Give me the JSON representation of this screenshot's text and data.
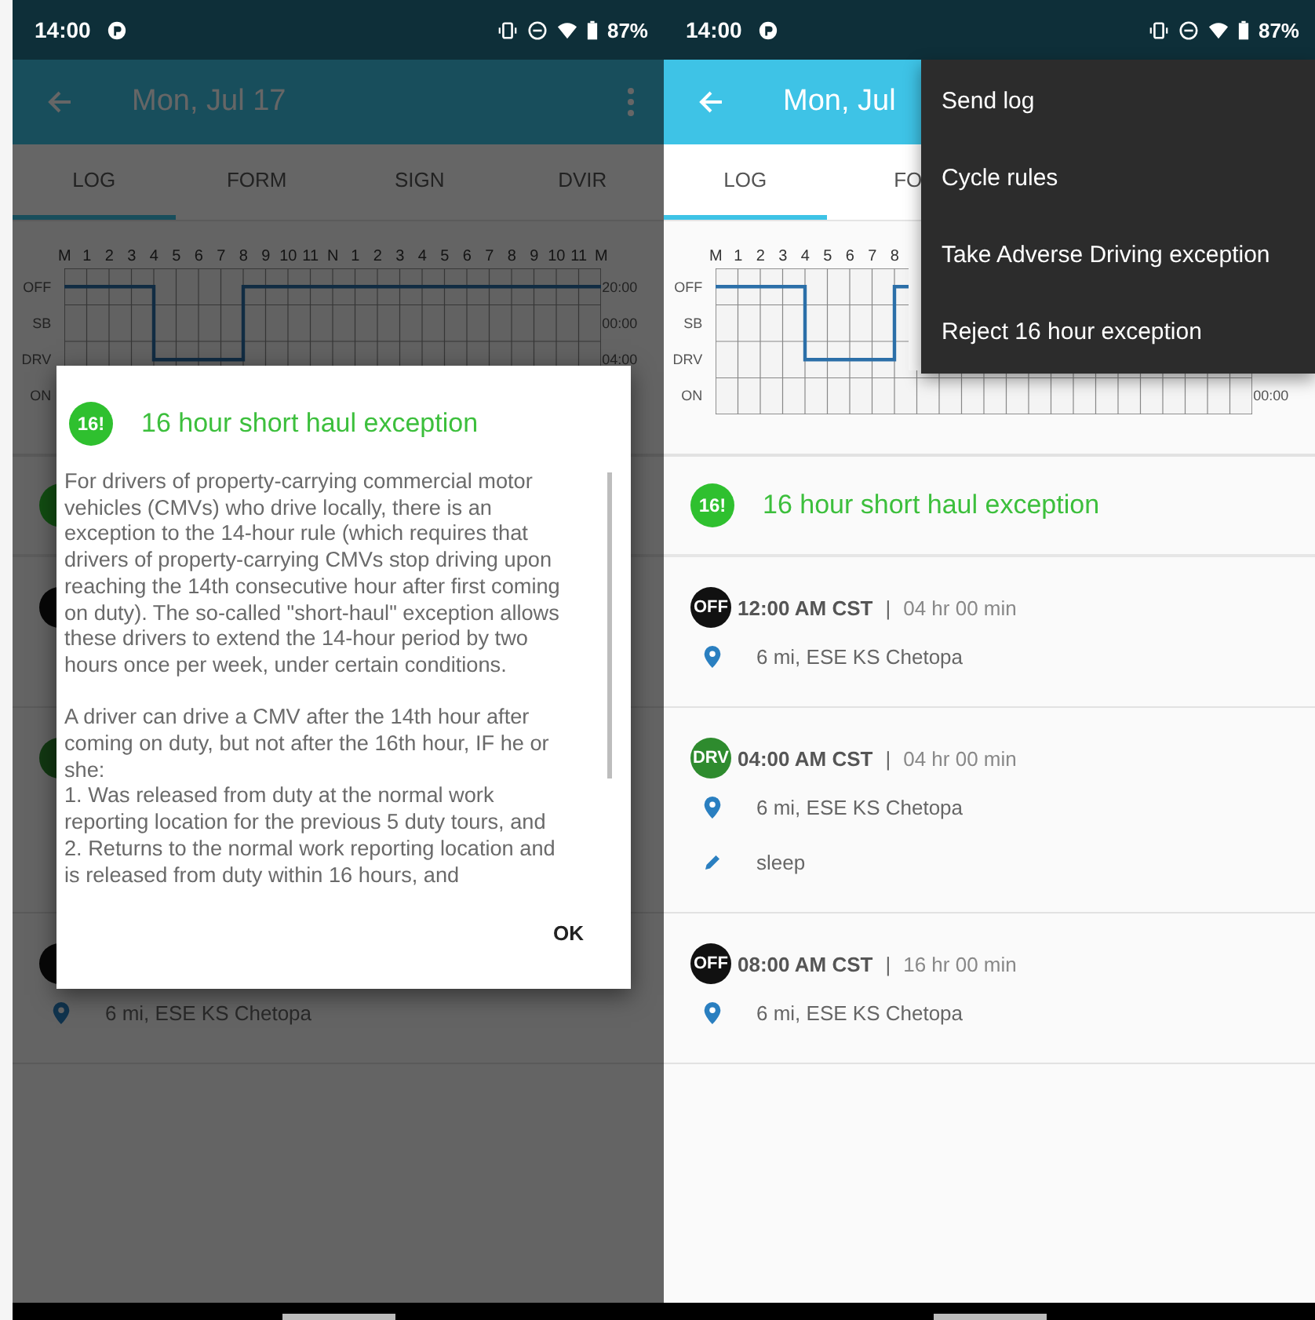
{
  "phones": [
    {
      "status_bar": {
        "time": "14:00",
        "battery": "87%"
      },
      "app_bar": {
        "title": "Mon, Jul 17",
        "more_icon": true
      },
      "tabs": [
        {
          "label": "LOG",
          "selected": true
        },
        {
          "label": "FORM",
          "selected": false
        },
        {
          "label": "SIGN",
          "selected": false
        },
        {
          "label": "DVIR",
          "selected": false
        }
      ],
      "log_chart": {
        "hours": [
          "M",
          "1",
          "2",
          "3",
          "4",
          "5",
          "6",
          "7",
          "8",
          "9",
          "10",
          "11",
          "N",
          "1",
          "2",
          "3",
          "4",
          "5",
          "6",
          "7",
          "8",
          "9",
          "10",
          "11",
          "M"
        ],
        "rows": [
          {
            "label": "OFF",
            "total": "20:00"
          },
          {
            "label": "SB",
            "total": "00:00"
          },
          {
            "label": "DRV",
            "total": "04:00"
          },
          {
            "label": "ON"
          }
        ]
      },
      "list": [
        {
          "kind": "exception"
        },
        {
          "kind": "event",
          "color": "#070707",
          "lines": [
            {
              "kind": "location"
            }
          ]
        },
        {
          "kind": "event",
          "color": "#123812",
          "lines": [
            {
              "kind": "location"
            },
            {
              "kind": "note"
            }
          ]
        },
        {
          "kind": "event",
          "color": "#070707",
          "lines": [
            {
              "kind": "location",
              "text": "6 mi, ESE KS Chetopa"
            }
          ]
        }
      ],
      "dialog": {
        "badge": "16!",
        "title": "16 hour short haul exception",
        "body": "For drivers of property-carrying commercial motor vehicles (CMVs) who drive locally, there is an exception to the 14-hour rule (which requires that drivers of property-carrying CMVs stop driving upon reaching the 14th consecutive hour after first coming on duty). The so-called \"short-haul\" exception allows these drivers to extend the 14-hour period by two hours once per week, under certain conditions.\n\nA driver can drive a CMV after the 14th hour after coming on duty, but not after the 16th hour, IF he or she:\n1. Was released from duty at the normal work reporting location for the previous 5 duty tours, and\n2. Returns to the normal work reporting location and is released from duty within 16 hours, and",
        "button": "OK"
      }
    },
    {
      "status_bar": {
        "time": "14:00",
        "battery": "87%"
      },
      "app_bar": {
        "title": "Mon, Jul"
      },
      "tabs": [
        {
          "label": "LOG",
          "selected": true
        },
        {
          "label": "FO",
          "selected": false
        }
      ],
      "log_chart": {
        "hours": [
          "M",
          "1",
          "2",
          "3",
          "4",
          "5",
          "6",
          "7",
          "8"
        ],
        "rows": [
          {
            "label": "OFF"
          },
          {
            "label": "SB"
          },
          {
            "label": "DRV"
          },
          {
            "label": "ON",
            "total": "00:00"
          }
        ]
      },
      "list": [
        {
          "kind": "exception",
          "badge": "16!",
          "title": "16 hour short haul exception"
        },
        {
          "kind": "event",
          "color": "#111111",
          "badge": "OFF",
          "time": "12:00 AM CST",
          "separator": "|",
          "duration": "04 hr 00 min",
          "lines": [
            {
              "kind": "location",
              "text": "6 mi, ESE KS Chetopa"
            }
          ]
        },
        {
          "kind": "event",
          "color": "#2e8b2e",
          "badge": "DRV",
          "time": "04:00 AM CST",
          "separator": "|",
          "duration": "04 hr 00 min",
          "lines": [
            {
              "kind": "location",
              "text": "6 mi, ESE KS Chetopa"
            },
            {
              "kind": "note",
              "text": "sleep"
            }
          ]
        },
        {
          "kind": "event",
          "color": "#111111",
          "badge": "OFF",
          "time": "08:00 AM CST",
          "separator": "|",
          "duration": "16 hr 00 min",
          "lines": [
            {
              "kind": "location",
              "text": "6 mi, ESE KS Chetopa"
            }
          ]
        }
      ],
      "menu": {
        "items": [
          "Send log",
          "Cycle rules",
          "Take Adverse Driving exception",
          "Reject 16 hour exception"
        ]
      }
    }
  ]
}
